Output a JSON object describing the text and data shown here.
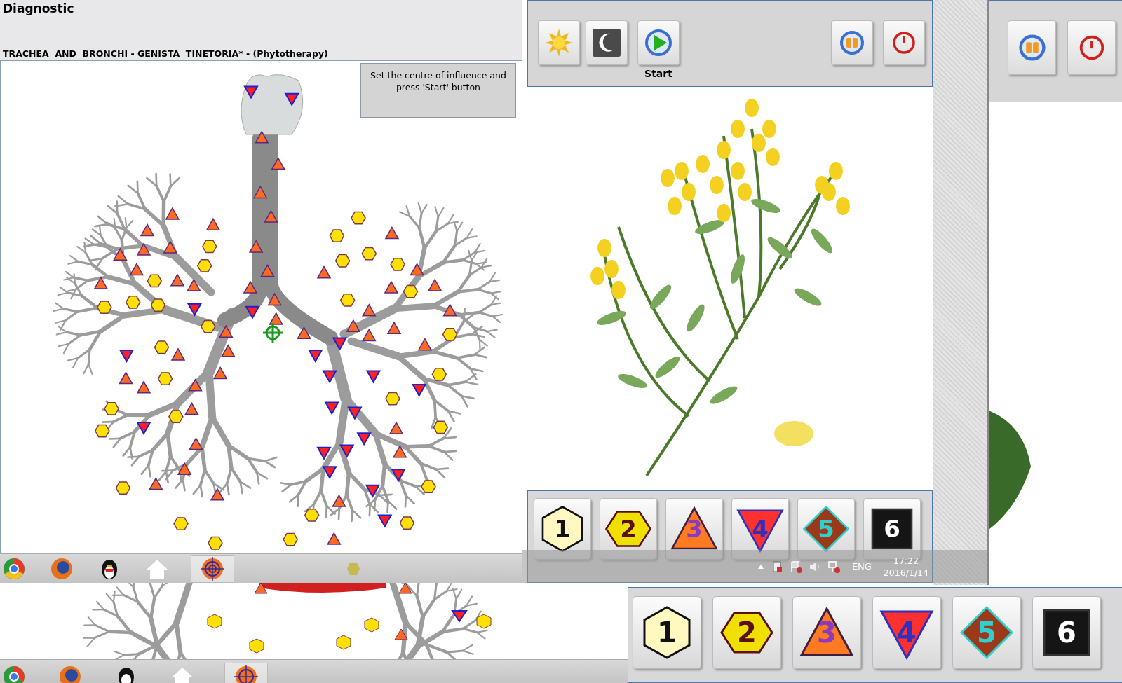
{
  "window": {
    "title": "Diagnostic",
    "subtitle": "TRACHEA  AND  BRONCHI - GENISTA  TINETORIA* - (Phytotherapy)",
    "hint": "Set the centre of influence and press 'Start' button"
  },
  "toolbar": [
    {
      "kind": "sun"
    },
    {
      "kind": "moon"
    },
    {
      "kind": "start",
      "label": "Start"
    },
    {
      "kind": "pause"
    },
    {
      "kind": "power"
    }
  ],
  "shape_buttons": [
    {
      "kind": "hexagon",
      "label": "1",
      "color": "#fff8c0"
    },
    {
      "kind": "wide-hexagon",
      "label": "2",
      "color": "#f0e000"
    },
    {
      "kind": "triangle",
      "label": "3",
      "color": "#ff7a20"
    },
    {
      "kind": "inverted-triangle",
      "label": "4",
      "color": "#ff3030"
    },
    {
      "kind": "diamond",
      "label": "5",
      "color": "#9a3a1a"
    },
    {
      "kind": "square",
      "label": "6",
      "color": "#151515"
    }
  ],
  "taskbar": {
    "items": [
      {
        "kind": "chrome",
        "selected": false
      },
      {
        "kind": "firefox",
        "selected": false
      },
      {
        "kind": "penguin",
        "selected": false
      },
      {
        "kind": "home",
        "selected": false
      },
      {
        "kind": "target",
        "selected": true
      }
    ],
    "tray": {
      "language": "ENG",
      "time": "17:22",
      "date": "2016/1/14"
    }
  },
  "second_window": {
    "toolbar": [
      {
        "kind": "pause"
      },
      {
        "kind": "power"
      }
    ]
  },
  "lower_taskbar": {
    "items": [
      {
        "kind": "chrome",
        "selected": false
      },
      {
        "kind": "firefox",
        "selected": false
      },
      {
        "kind": "penguin",
        "selected": false
      },
      {
        "kind": "home",
        "selected": false
      },
      {
        "kind": "target",
        "selected": true
      }
    ]
  },
  "lower_shape_buttons": [
    {
      "kind": "hexagon",
      "label": "1",
      "color": "#fff8c0"
    },
    {
      "kind": "wide-hexagon",
      "label": "2",
      "color": "#f0e000"
    },
    {
      "kind": "triangle",
      "label": "3",
      "color": "#ff7a20"
    },
    {
      "kind": "inverted-triangle",
      "label": "4",
      "color": "#ff3030"
    },
    {
      "kind": "diamond",
      "label": "5",
      "color": "#9a3a1a"
    },
    {
      "kind": "square",
      "label": "6",
      "color": "#151515"
    }
  ]
}
